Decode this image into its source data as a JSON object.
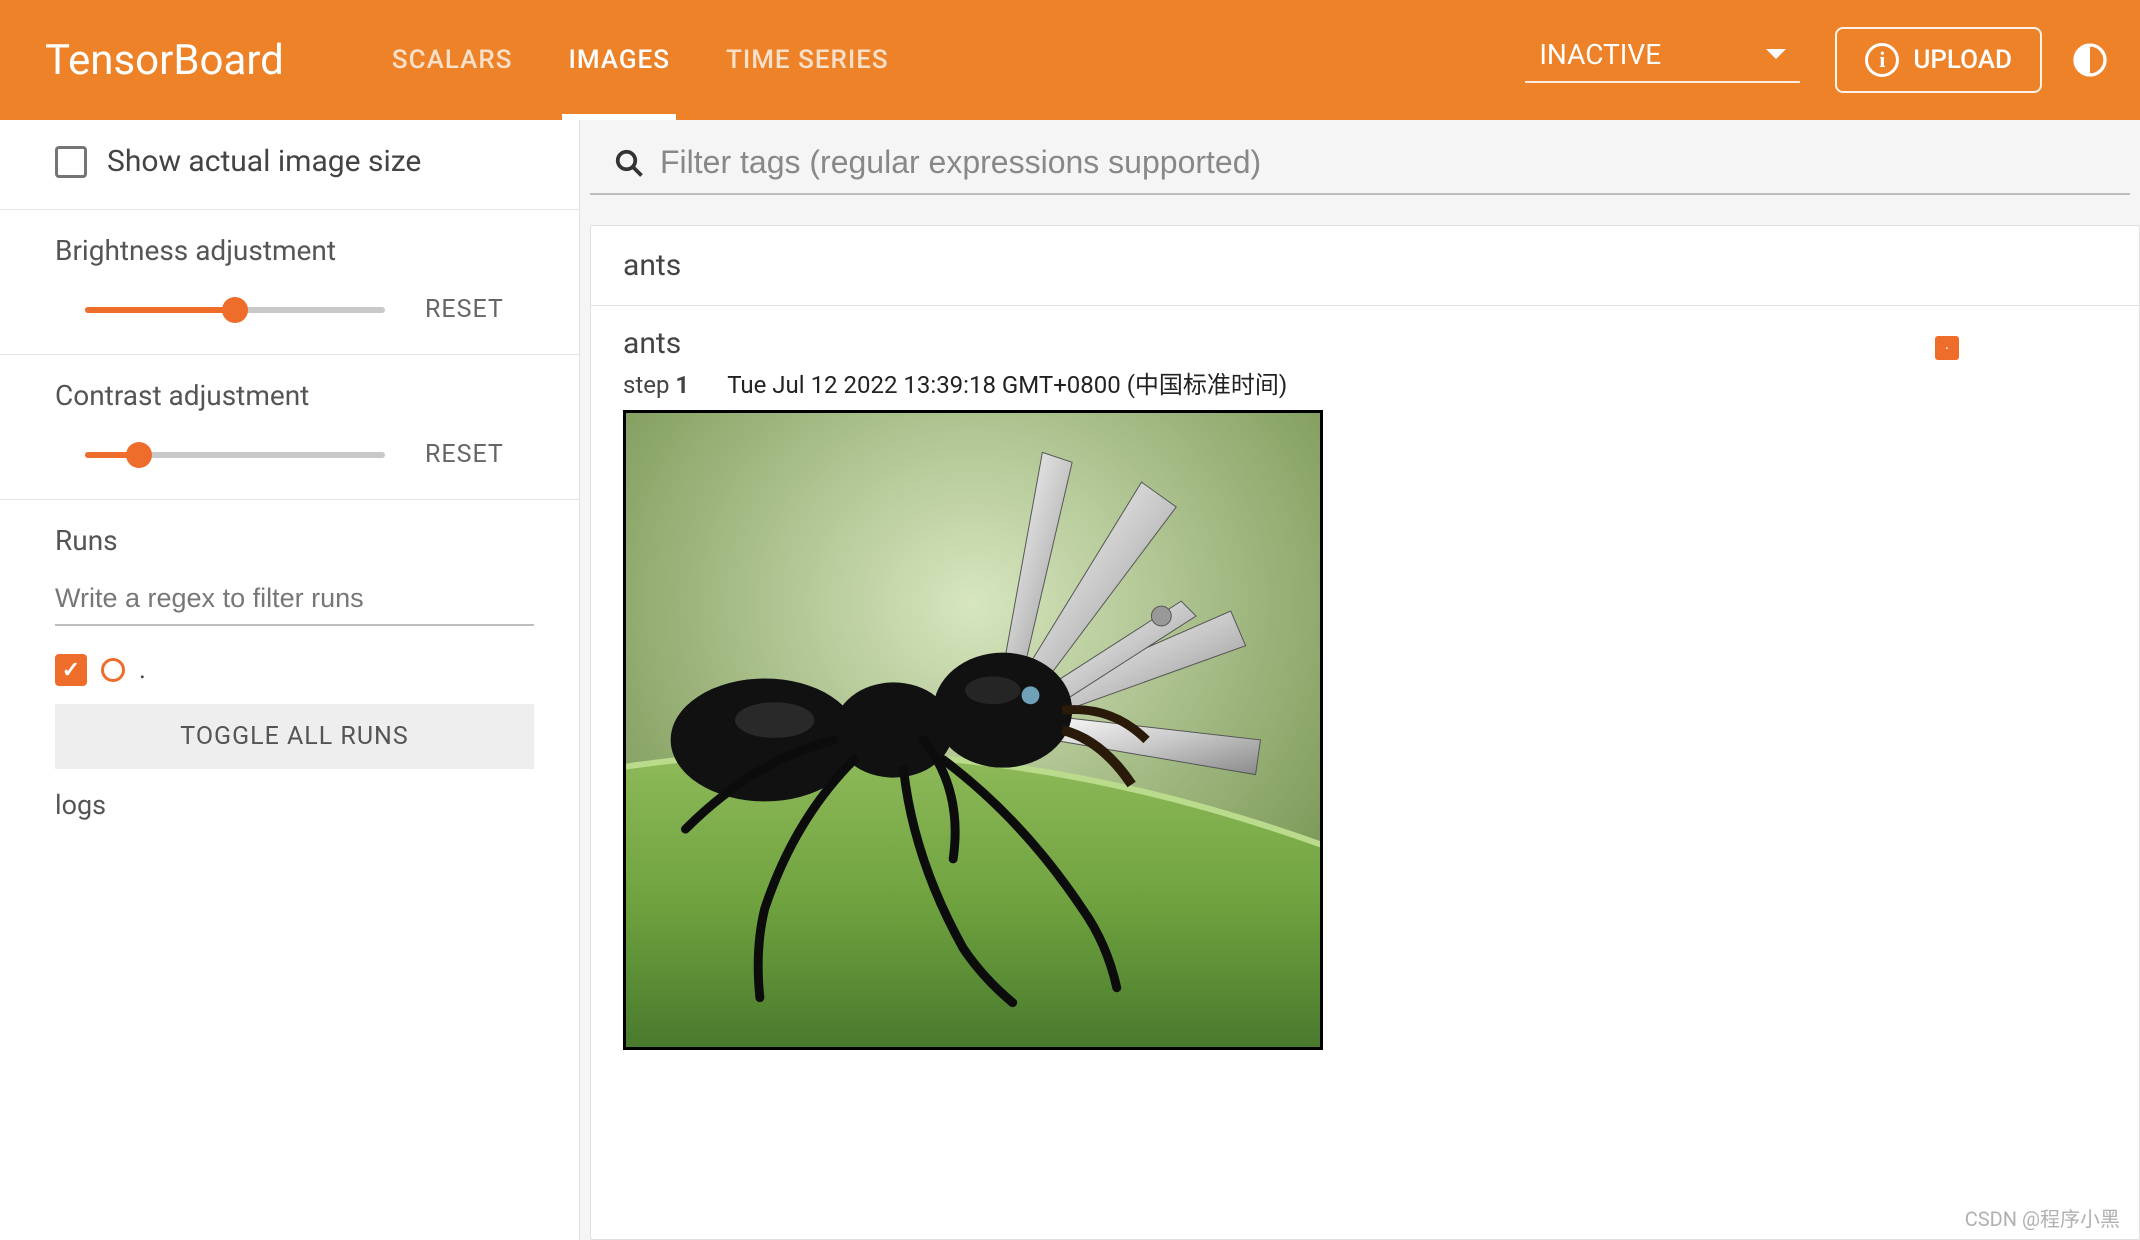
{
  "header": {
    "logo": "TensorBoard",
    "tabs": [
      {
        "label": "SCALARS",
        "active": false
      },
      {
        "label": "IMAGES",
        "active": true
      },
      {
        "label": "TIME SERIES",
        "active": false
      }
    ],
    "inactive_label": "INACTIVE",
    "upload_label": "UPLOAD"
  },
  "sidebar": {
    "show_actual_label": "Show actual image size",
    "brightness": {
      "label": "Brightness adjustment",
      "value": 50,
      "reset": "RESET"
    },
    "contrast": {
      "label": "Contrast adjustment",
      "value": 18,
      "reset": "RESET"
    },
    "runs": {
      "label": "Runs",
      "placeholder": "Write a regex to filter runs",
      "items": [
        {
          "name": ".",
          "checked": true
        }
      ],
      "toggle_label": "TOGGLE ALL RUNS",
      "logs_label": "logs"
    }
  },
  "main": {
    "filter_placeholder": "Filter tags (regular expressions supported)",
    "tag_group": "ants",
    "image_card": {
      "title": "ants",
      "step_prefix": "step ",
      "step": "1",
      "timestamp": "Tue Jul 12 2022 13:39:18 GMT+0800 (中国标准时间)"
    }
  },
  "watermark": "CSDN @程序小黑"
}
